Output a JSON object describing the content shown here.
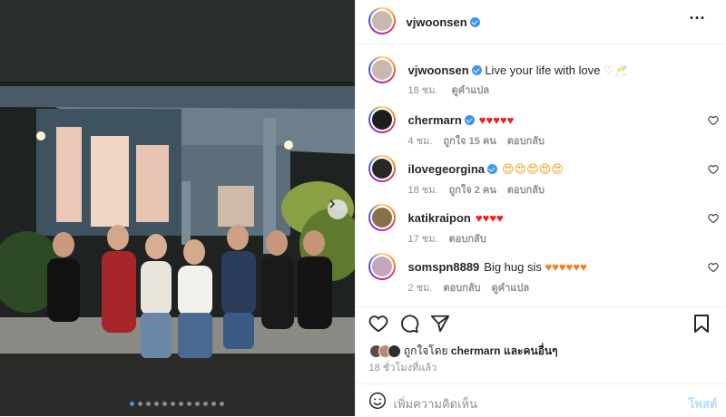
{
  "post": {
    "author": "vjwoonsen",
    "caption": "Live your life with love",
    "caption_time": "18 ชม.",
    "translate": "ดูคำแปล",
    "likes_prefix": "ถูกใจโดย",
    "likes_user": "chermarn",
    "likes_suffix": "และคนอื่นๆ",
    "posted": "18 ชั่วโมงที่แล้ว",
    "add_comment_placeholder": "เพิ่มความคิดเห็น",
    "post_button": "โพสต์",
    "carousel": {
      "slides": 12,
      "active": 0
    }
  },
  "comments": [
    {
      "user": "chermarn",
      "verified": true,
      "text": "♥♥♥♥♥",
      "emoji_color": "#ed1c24",
      "time": "4 ชม.",
      "likes": "ถูกใจ 15 คน",
      "reply": "ตอบกลับ",
      "translate": ""
    },
    {
      "user": "ilovegeorgina",
      "verified": true,
      "text": "😍😍😍😍😍",
      "emoji_color": "#f4a020",
      "time": "18 ชม.",
      "likes": "ถูกใจ 2 คน",
      "reply": "ตอบกลับ",
      "translate": ""
    },
    {
      "user": "katikraipon",
      "verified": false,
      "text": "♥♥♥♥",
      "emoji_color": "#ed1c24",
      "time": "17 ชม.",
      "likes": "",
      "reply": "ตอบกลับ",
      "translate": ""
    },
    {
      "user": "somspn8889",
      "verified": false,
      "text": "Big hug sis ♥♥♥♥♥♥",
      "emoji_color": "#f47b20",
      "time": "2 ชม.",
      "likes": "",
      "reply": "ตอบกลับ",
      "translate": "ดูคำแปล"
    }
  ],
  "colors": {
    "verified": "#3897f0",
    "heart_red": "#ed1c24",
    "heart_orange": "#f47b20",
    "post_disabled": "#b2dffc"
  }
}
